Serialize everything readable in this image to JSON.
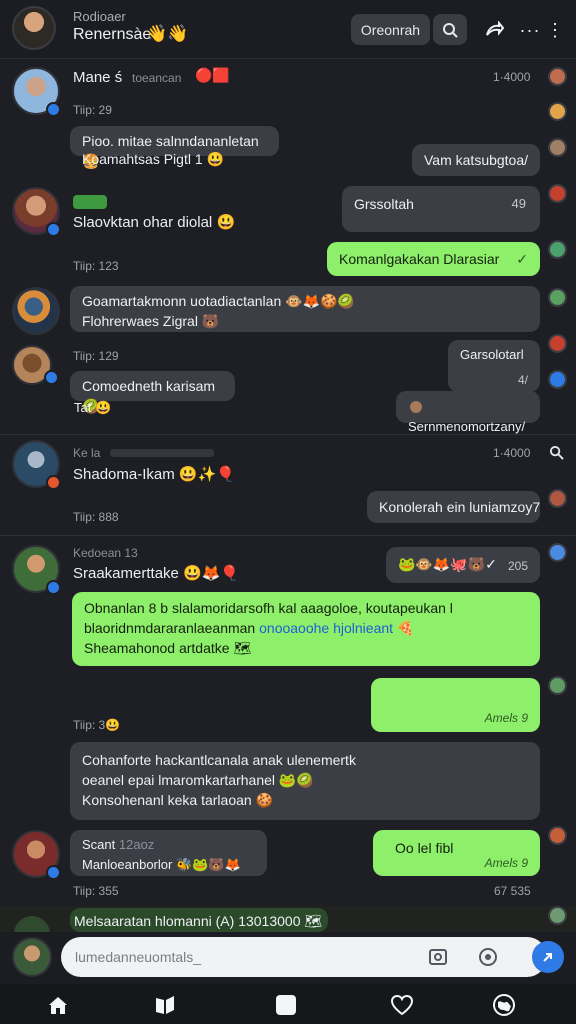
{
  "header": {
    "subtitle": "Rodioaer",
    "title": "Renernsàe",
    "title_emoji": "👋👋",
    "button_primary": "Oreonrah",
    "icons": [
      "search-icon",
      "share-icon",
      "more-icon",
      "more-vertical-icon"
    ]
  },
  "messages": [
    {
      "name": "Mane ś",
      "faint_label": "toeancan",
      "name_emoji": "🔴🟥",
      "time_right": "1·4000",
      "meta": "Tiip: 29",
      "bubble_left_1": "Pioo. mitae salnndananletan",
      "bubble_left_1_emoji": "🍔",
      "bubble_left_2": "Koamahtsas Pigtl 1",
      "bubble_left_2_emoji": "😃",
      "bubble_right": "Vam katsubgtoa/"
    },
    {
      "name": "Slaovktan ohar diolal",
      "name_emoji": "😃",
      "meta": "Tiip: 123",
      "bubble_right_dark": "Grssoltah",
      "bubble_right_dark_meta": "49",
      "bubble_green": "Komanlgakakan Dlarasiar",
      "bubble_green_meta": "✓"
    },
    {
      "line_1": "Goamartakmonn uotadiactanlan",
      "line_1_emoji": "🐵🦊🍪🥝",
      "line_2": "Flohrerwaes Zigral",
      "line_2_emoji": "🐻",
      "meta": "Tiip: 129",
      "bubble_right_dark": "Garsolotarl",
      "bubble_right_dark_meta": "4/",
      "bubble_left": "Comoedneth karisam",
      "bubble_left_emoji": "🥝",
      "bubble_left_sub": "Tat",
      "bubble_left_sub_emoji": "😃",
      "bubble_right_2": "Sernmenomortzany/"
    },
    {
      "faint_label": "Ke la",
      "time_right": "1·4000",
      "name": "Shadoma-Ikam",
      "name_emoji": "😃✨🎈",
      "bubble_right": "Konolerah ein luniamzoy7",
      "meta": "Tiip: 888"
    },
    {
      "faint_label": "Kedoean 13",
      "name": "Sraakamerttake",
      "name_emoji": "😃🦊🎈",
      "reactions": "🐸🐵🦊🐙🐻✓",
      "reactions_count": "205",
      "green_line_1": "Obnanlan 8 b slalamoridarsofh kal aaagoloe, koutapeukan l",
      "green_line_2": "blaoridnmdararanlaeanman",
      "green_link": "onooaoohe hjolnieant",
      "green_line_2_emoji": "🍕",
      "green_line_3": "Sheamahonod artdatke",
      "green_line_3_emoji": "🗺",
      "green_empty_meta": "Amels 9",
      "meta": "Tiip: 3",
      "meta_emoji": "😃",
      "dark_line_1": "Cohanforte hackantlcanala anak ulenemertk",
      "dark_line_2": "oeanel epai lmaromkartarhanel",
      "dark_line_2_emoji": "🐸🥝",
      "dark_line_3": "Konsohenanl keka tarlaoan",
      "dark_line_3_emoji": "🍪"
    },
    {
      "name": "Scant",
      "faint_label": "12aoz",
      "sub": "Manloeanborlor",
      "sub_emoji": "🐝🐸🐻🦊",
      "bubble_green": "Oo lel fibl",
      "bubble_green_meta": "Amels 9",
      "meta": "Tiip: 355",
      "time_right": "67 535"
    },
    {
      "pinned": "Melsaaratan hlomanni",
      "pinned_number": "(A) 13013000",
      "pinned_emoji": "🗺"
    }
  ],
  "composer": {
    "placeholder": "lumedanneuomtals_"
  },
  "nav": [
    "home-icon",
    "book-icon",
    "square-icon",
    "heart-icon",
    "globe-icon"
  ]
}
